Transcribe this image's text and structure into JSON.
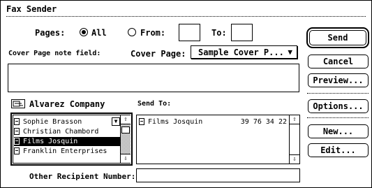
{
  "window": {
    "title": "Fax Sender"
  },
  "pages": {
    "label": "Pages:",
    "all_label": "All",
    "from_label": "From:",
    "to_label": "To:",
    "from_value": "",
    "to_value": "",
    "selected": "all"
  },
  "cover": {
    "note_label": "Cover Page note field:",
    "page_label": "Cover Page:",
    "page_value": "Sample Cover P...",
    "note_value": ""
  },
  "address_book": {
    "name": "Alvarez Company",
    "items": [
      {
        "label": "Sophie Brasson",
        "selected": false
      },
      {
        "label": "Christian Chambord",
        "selected": false
      },
      {
        "label": "Films Josquin",
        "selected": true
      },
      {
        "label": "Franklin Enterprises",
        "selected": false
      }
    ]
  },
  "send_to": {
    "label": "Send To:",
    "items": [
      {
        "name": "Films Josquin",
        "number": "39 76 34 22"
      }
    ]
  },
  "other_recipient": {
    "label": "Other Recipient Number:",
    "value": ""
  },
  "buttons": {
    "send": "Send",
    "cancel": "Cancel",
    "preview": "Preview...",
    "options": "Options...",
    "new": "New...",
    "edit": "Edit..."
  },
  "icons": {
    "popup_arrow": "triangle-down-icon",
    "scroll_up": "arrow-up-icon",
    "scroll_down": "arrow-down-icon",
    "address_book": "address-book-icon",
    "card": "card-icon"
  }
}
